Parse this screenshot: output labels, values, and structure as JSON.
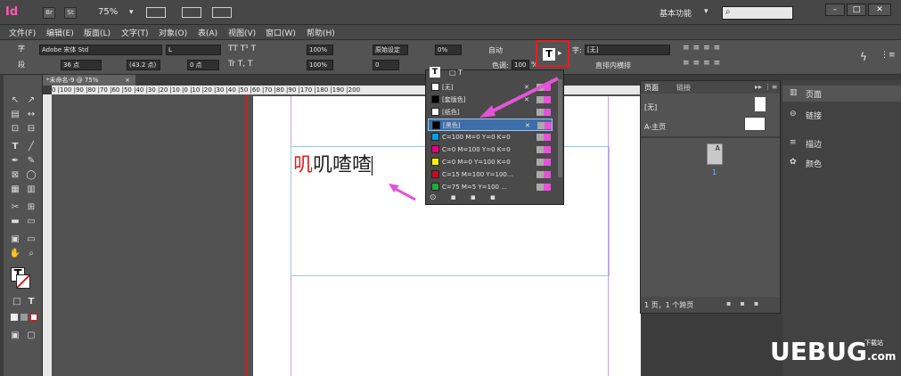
{
  "app": {
    "logo": "Id",
    "zoom": "75%",
    "workspace": "基本功能",
    "br": "Br",
    "st": "St"
  },
  "menu": [
    "文件(F)",
    "编辑(E)",
    "版面(L)",
    "文字(T)",
    "对象(O)",
    "表(A)",
    "视图(V)",
    "窗口(W)",
    "帮助(H)"
  ],
  "control": {
    "font_family": "Adobe 宋体 Std",
    "font_style": "L",
    "font_size": "36 点",
    "leading": "(43.2 点)",
    "tracking_value": "0 点",
    "h_scale": "100%",
    "v_scale": "100%",
    "kerning": "原始设定",
    "tracking": "0%",
    "auto_label": "自动",
    "baseline": "0",
    "tint_label": "色调:",
    "tint_value": "100",
    "char_style": "[无]",
    "char_style_label": "字:",
    "vertical_label": "直排内横排",
    "percent_sign": "%"
  },
  "document": {
    "tab_title": "*未命名-9 @ 75%",
    "text_red": "叽",
    "text_black": "叽喳喳"
  },
  "swatches": [
    {
      "name": "[无]",
      "color": "#ffffff",
      "x": "✕",
      "selected": false
    },
    {
      "name": "[套版色]",
      "color": "#000000",
      "x": "✕",
      "selected": false
    },
    {
      "name": "[纸色]",
      "color": "#ffffff",
      "x": "",
      "selected": false
    },
    {
      "name": "[黑色]",
      "color": "#000000",
      "x": "✕",
      "selected": true
    },
    {
      "name": "C=100 M=0 Y=0 K=0",
      "color": "#00a0e9",
      "x": "",
      "selected": false
    },
    {
      "name": "C=0 M=100 Y=0 K=0",
      "color": "#e4007f",
      "x": "",
      "selected": false
    },
    {
      "name": "C=0 M=0 Y=100 K=0",
      "color": "#fff100",
      "x": "",
      "selected": false
    },
    {
      "name": "C=15 M=100 Y=100...",
      "color": "#c30d23",
      "x": "",
      "selected": false
    },
    {
      "name": "C=75 M=5 Y=100 ...",
      "color": "#22ac38",
      "x": "",
      "selected": false
    }
  ],
  "pages_panel": {
    "tab_pages": "页面",
    "tab_links": "链接",
    "none_master": "[无]",
    "a_master": "A-主页",
    "page_num": "1",
    "master_letter": "A",
    "footer": "1 页，1 个跨页"
  },
  "right_panel": {
    "pages": "页面",
    "links": "链接",
    "stroke": "描边",
    "swatches": "颜色"
  },
  "ruler": "0 |100 |90 |80 |70 |60 |50 |40 |30 |20 |10 |0 |10 |20 |30 |40 |50 |60 |70 |80 |90 |170 |180 |190 |200",
  "watermark": "UEBUG",
  "watermark_com": ".com",
  "watermark_top": "下载站",
  "colors": {
    "accent_pink": "#e455d6",
    "highlight_red": "#e02020",
    "selection_blue": "#3d6ea8"
  }
}
